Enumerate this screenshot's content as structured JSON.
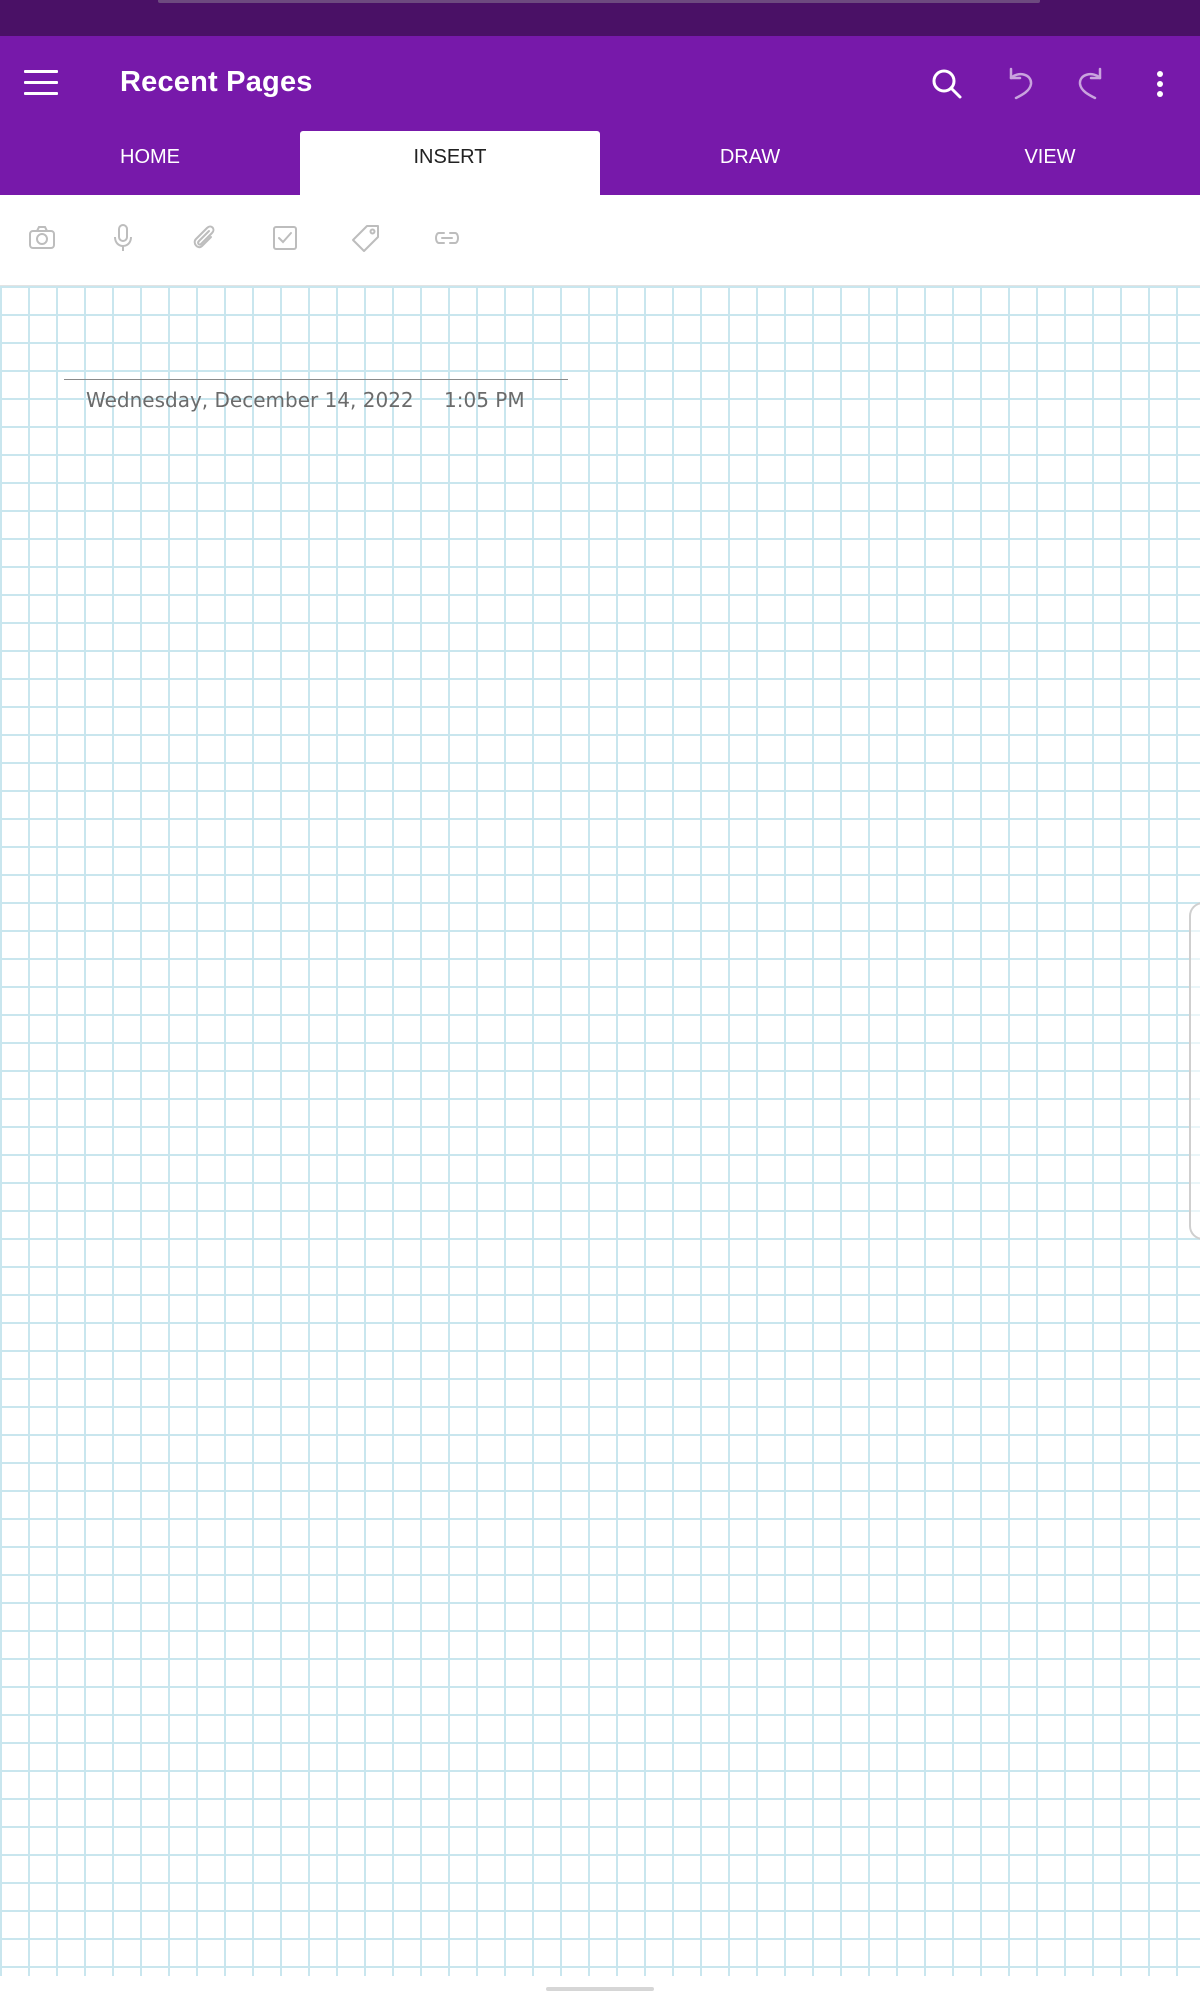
{
  "app_bar": {
    "title": "Recent Pages",
    "icons": {
      "menu": "hamburger-menu-icon",
      "search": "search-icon",
      "undo": "undo-icon",
      "redo": "redo-icon",
      "more": "more-vertical-icon"
    }
  },
  "tabs": [
    {
      "label": "HOME",
      "active": false
    },
    {
      "label": "INSERT",
      "active": true
    },
    {
      "label": "DRAW",
      "active": false
    },
    {
      "label": "VIEW",
      "active": false
    }
  ],
  "ribbon": {
    "tools": [
      "camera-icon",
      "microphone-icon",
      "paperclip-icon",
      "checkbox-icon",
      "tag-icon",
      "link-icon"
    ]
  },
  "page": {
    "date": "Wednesday, December 14, 2022",
    "time": "1:05 PM"
  },
  "colors": {
    "brand": "#7719aa",
    "status_bar": "#4a1166",
    "grid_line": "#c9e6ee",
    "ribbon_icon": "#bdbdbd"
  }
}
